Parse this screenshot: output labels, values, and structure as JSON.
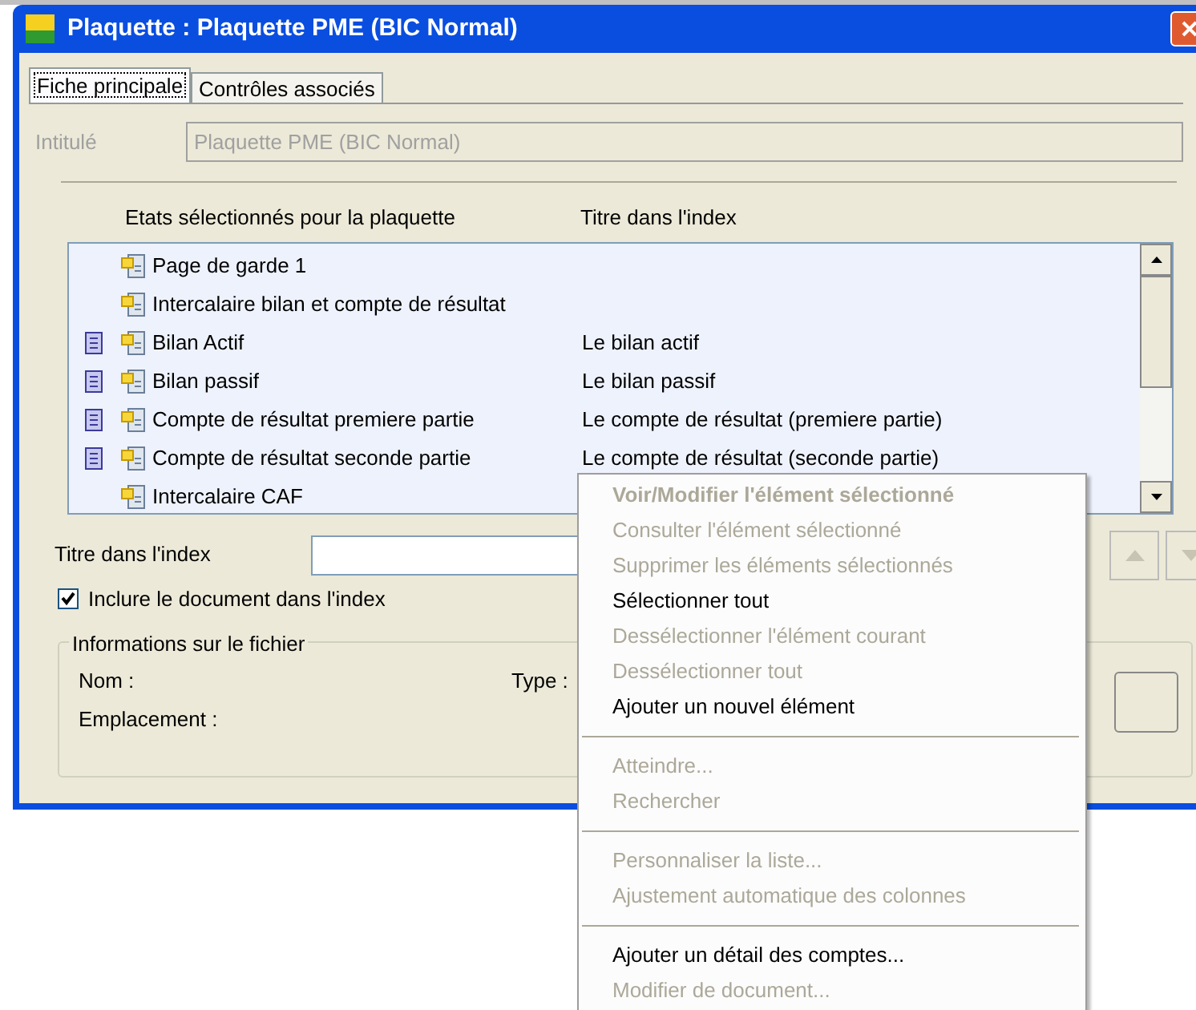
{
  "window": {
    "title": "Plaquette : Plaquette PME (BIC Normal)"
  },
  "tabs": [
    {
      "label": "Fiche principale",
      "selected": true
    },
    {
      "label": "Contrôles associés",
      "selected": false
    }
  ],
  "intitule": {
    "label": "Intitulé",
    "value": "Plaquette PME (BIC Normal)",
    "disabled": true
  },
  "table": {
    "columns": [
      "Etats sélectionnés pour la plaquette",
      "Titre dans l'index"
    ],
    "rows": [
      {
        "name": "Page de garde 1",
        "in_index": false,
        "index_title": ""
      },
      {
        "name": "Intercalaire bilan et compte de résultat",
        "in_index": false,
        "index_title": ""
      },
      {
        "name": "Bilan Actif",
        "in_index": true,
        "index_title": "Le bilan actif"
      },
      {
        "name": "Bilan passif",
        "in_index": true,
        "index_title": "Le bilan passif"
      },
      {
        "name": "Compte de résultat premiere partie",
        "in_index": true,
        "index_title": "Le compte de résultat (premiere partie)"
      },
      {
        "name": "Compte de résultat seconde partie",
        "in_index": true,
        "index_title": "Le compte de résultat (seconde partie)"
      },
      {
        "name": "Intercalaire CAF",
        "in_index": false,
        "index_title": ""
      }
    ]
  },
  "index_title_field": {
    "label": "Titre dans l'index"
  },
  "include_checkbox": {
    "label": "Inclure le document dans l'index",
    "checked": true
  },
  "file_info": {
    "title": "Informations sur le fichier",
    "nom": "Nom :",
    "type": "Type :",
    "emplacement": "Emplacement :"
  },
  "context_menu": {
    "groups": [
      [
        {
          "label": "Voir/Modifier l'élément sélectionné",
          "disabled": true,
          "default": true
        },
        {
          "label": "Consulter l'élément sélectionné",
          "disabled": true,
          "default": false
        },
        {
          "label": "Supprimer les éléments sélectionnés",
          "disabled": true,
          "default": false
        },
        {
          "label": "Sélectionner tout",
          "disabled": false,
          "default": false
        },
        {
          "label": "Dessélectionner l'élément courant",
          "disabled": true,
          "default": false
        },
        {
          "label": "Dessélectionner tout",
          "disabled": true,
          "default": false
        },
        {
          "label": "Ajouter un nouvel élément",
          "disabled": false,
          "default": false
        }
      ],
      [
        {
          "label": "Atteindre...",
          "disabled": true,
          "default": false
        },
        {
          "label": "Rechercher",
          "disabled": true,
          "default": false
        }
      ],
      [
        {
          "label": "Personnaliser la liste...",
          "disabled": true,
          "default": false
        },
        {
          "label": "Ajustement automatique des colonnes",
          "disabled": true,
          "default": false
        }
      ],
      [
        {
          "label": "Ajouter un détail des comptes...",
          "disabled": false,
          "default": false
        },
        {
          "label": "Modifier de document...",
          "disabled": true,
          "default": false
        }
      ]
    ]
  }
}
